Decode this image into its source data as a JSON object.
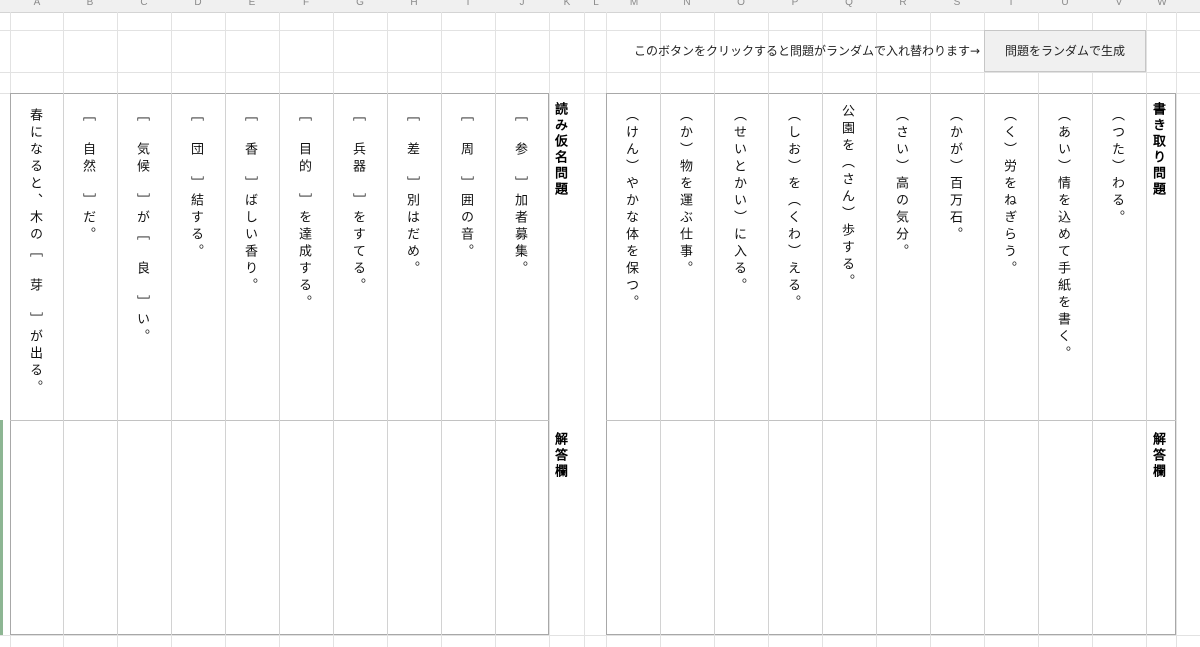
{
  "columns": [
    "A",
    "B",
    "C",
    "D",
    "E",
    "F",
    "G",
    "H",
    "I",
    "J",
    "K",
    "L",
    "M",
    "N",
    "O",
    "P",
    "Q",
    "R",
    "S",
    "T",
    "U",
    "V",
    "W"
  ],
  "instruction": "このボタンをクリックすると問題がランダムで入れ替わります→",
  "generate_button": "問題をランダムで生成",
  "reading_section": {
    "title": "読み仮名問題",
    "answer_label": "解答欄",
    "questions": [
      "［　参　］加者募集。",
      "［　周　］囲の音。",
      "［　差　］別はだめ。",
      "［　兵器　］をすてる。",
      "［　目的　］を達成する。",
      "［　香　］ばしい香り。",
      "［　団　］結する。",
      "［　気候　］が［　良　］い。",
      "［　自然　］だ。",
      "春になると、木の［　芽　］が出る。"
    ]
  },
  "writing_section": {
    "title": "書き取り問題",
    "answer_label": "解答欄",
    "questions": [
      "（つた）わる。",
      "（あい）情を込めて手紙を書く。",
      "（く）労をねぎらう。",
      "（かが）百万石。",
      "（さい）高の気分。",
      "公園を（さん）歩する。",
      "（しお）を（くわ）える。",
      "（せいとかい）に入る。",
      "（か）物を運ぶ仕事。",
      "（けん）やかな体を保つ。"
    ]
  }
}
